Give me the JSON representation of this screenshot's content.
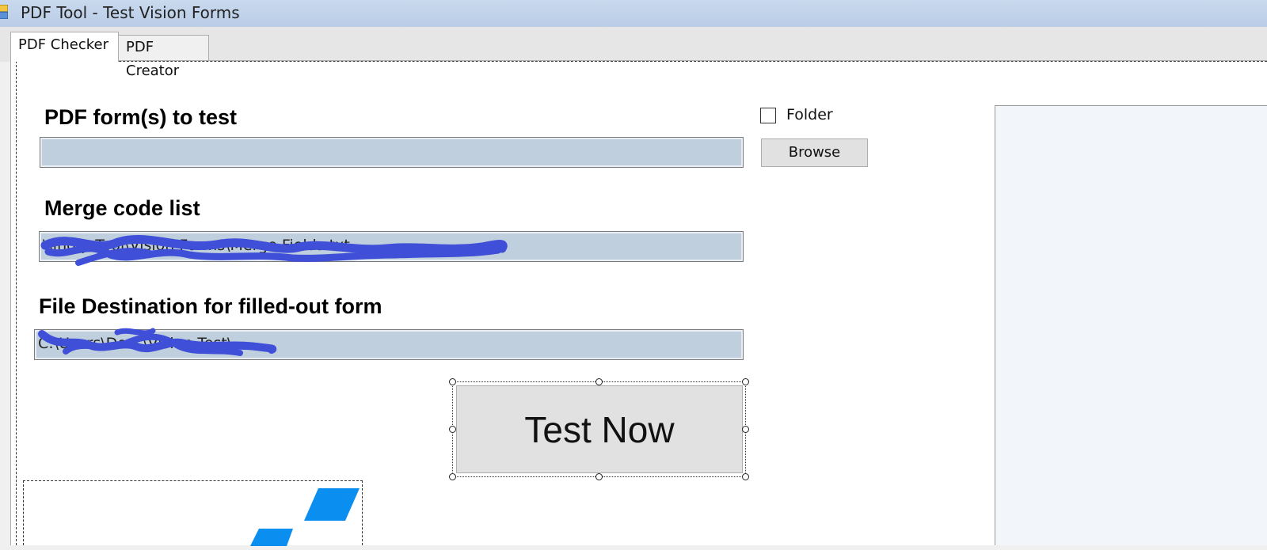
{
  "window": {
    "title": "PDF Tool - Test Vision Forms",
    "app_icon": "app-icon"
  },
  "tabs": [
    {
      "label": "PDF Checker",
      "active": true
    },
    {
      "label": "PDF Creator",
      "active": false
    }
  ],
  "form": {
    "pdf_forms_label": "PDF form(s) to test",
    "pdf_forms_value": "",
    "folder_checkbox_label": "Folder",
    "folder_checked": false,
    "browse_label": "Browse",
    "merge_label": "Merge code list",
    "merge_value": "\\\\ind             p             Tool\\Vision Forms\\Merge Fields.txt",
    "destination_label": "File Destination for filled-out form",
    "destination_value": "C:\\Users\\Docs\\Vision Test\\",
    "test_button_label": "Test Now"
  },
  "colors": {
    "field_bg": "#bfcfdd",
    "redaction": "#3f4fd8",
    "logo_blue": "#0a8ef0",
    "titlebar": "#c2d4ec"
  }
}
